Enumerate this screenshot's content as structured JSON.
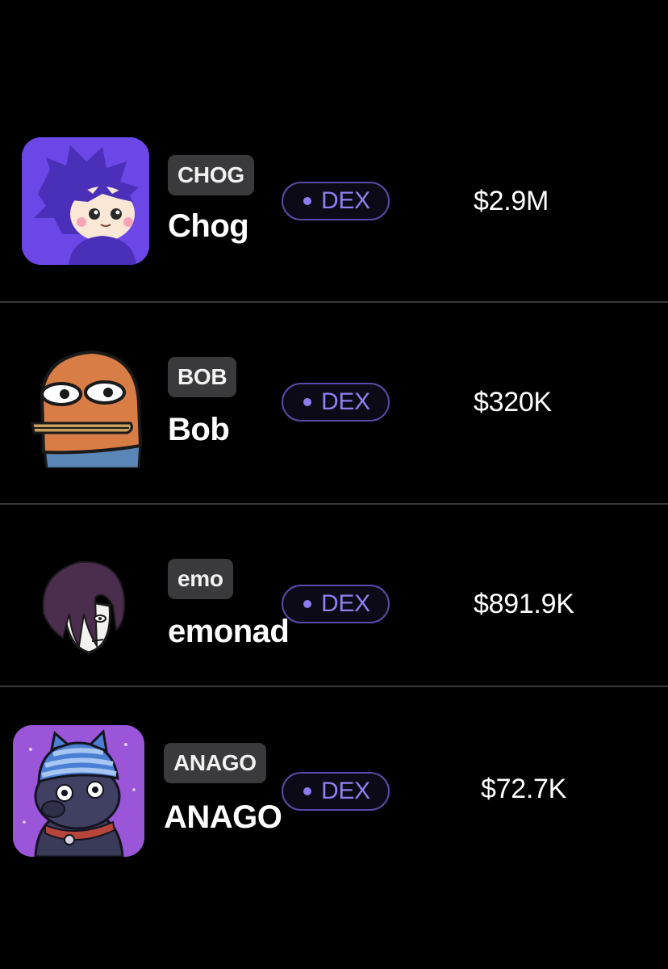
{
  "colors": {
    "background": "#000000",
    "divider": "#3a3a3a",
    "ticker_bg": "#3a3a3c",
    "badge_border": "#5a4aa8",
    "badge_text": "#8e80ef"
  },
  "tokens": [
    {
      "ticker": "CHOG",
      "name": "Chog",
      "market": "DEX",
      "value": "$2.9M",
      "icon": "chog-avatar-icon"
    },
    {
      "ticker": "BOB",
      "name": "Bob",
      "market": "DEX",
      "value": "$320K",
      "icon": "bob-avatar-icon"
    },
    {
      "ticker": "emo",
      "name": "emonad",
      "market": "DEX",
      "value": "$891.9K",
      "icon": "emo-avatar-icon"
    },
    {
      "ticker": "ANAGO",
      "name": "ANAGO",
      "market": "DEX",
      "value": "$72.7K",
      "icon": "anago-avatar-icon"
    }
  ]
}
